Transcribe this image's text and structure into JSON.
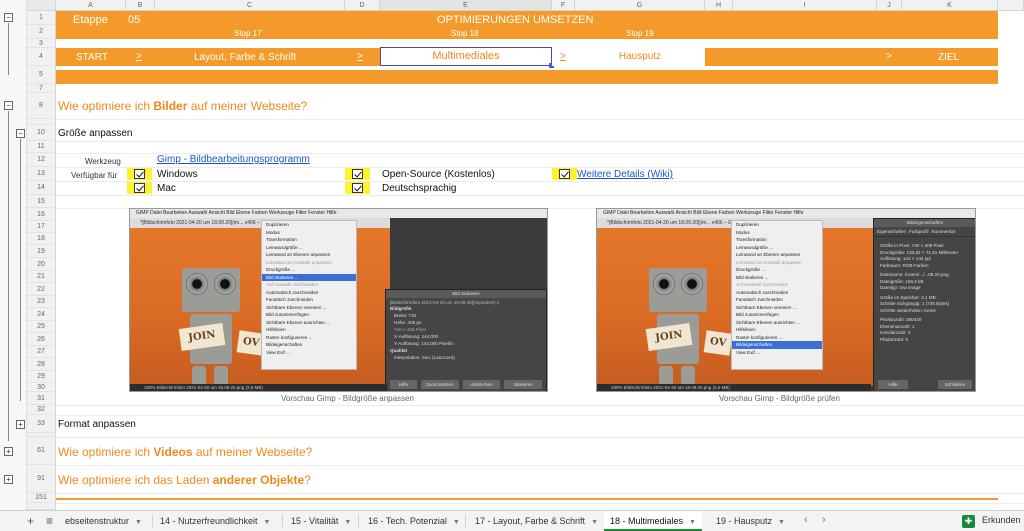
{
  "columns": [
    "A",
    "B",
    "C",
    "D",
    "E",
    "F",
    "G",
    "H",
    "I",
    "J",
    "K"
  ],
  "rows": [
    "1",
    "2",
    "3",
    "4",
    "5",
    "7",
    "8",
    "9",
    "10",
    "11",
    "12",
    "13",
    "14",
    "15",
    "16",
    "17",
    "18",
    "19",
    "20",
    "21",
    "22",
    "23",
    "24",
    "25",
    "26",
    "27",
    "28",
    "29",
    "30",
    "31",
    "32",
    "33",
    "61",
    "91",
    "151"
  ],
  "banner": {
    "etappe_label": "Etappe",
    "etappe_num": "05",
    "title": "OPTIMIERUNGEN UMSETZEN",
    "stops": [
      "Stop 17",
      "Stop 18",
      "Stop 19"
    ],
    "nav_start": "START",
    "nav_arrow": ">",
    "nav_items": [
      "Layout, Farbe & Schrift",
      "Multimediales",
      "Hausputz"
    ],
    "nav_end": "ZIEL"
  },
  "section_images": {
    "prefix": "Wie optimiere ich ",
    "bold": "Bilder",
    "suffix": " auf meiner Webseite?"
  },
  "subsection_resize": "Größe anpassen",
  "tool": {
    "label": "Werkzeug",
    "value": "Gimp - Bildbearbeitungsprogramm",
    "available_label": "Verfügbar für",
    "windows": "Windows",
    "mac": "Mac",
    "open_source": "Open-Source (Kostenlos)",
    "german": "Deutschsprachig",
    "details_link": "Weitere Details (Wiki)"
  },
  "screenshot_left": {
    "menubar": "  GIMP   Datei   Bearbeiten   Auswahl   Ansicht   Bild   Ebene   Farben   Werkzeuge   Filter   Fenster   Hilfe",
    "window_title": "*[Bildschirmfoto 2021-04-20 um 18.09.20](im...   x406 – GIMP",
    "menu_items": [
      "Duplizieren",
      "Modus",
      "Transformation",
      "Leinwandgröße ...",
      "Leinwand an Ebenen anpassen",
      "Leinwand an Auswahl anpassen",
      "Druckgröße ...",
      "Bild skalieren ...",
      "Auf Auswahl zuschneiden",
      "Automatisch zuschneiden",
      "Fanatisch zuschneiden",
      "Sichtbare Ebenen vereinen ...",
      "Bild zusammenfügen",
      "Sichtbare Ebenen ausrichten ...",
      "Hilfslinien",
      "Raster konfigurieren ...",
      "Bildeigenschaften",
      "View Exif ..."
    ],
    "dialog_title": "Bild skalieren",
    "dialog_sub": "[Bildschirmfoto 2021-04-20 um 18.09.20](importiert)-1",
    "dialog_lines": [
      "Bildgröße",
      "Breite:   740",
      "Höhe:     406    px",
      "740 × 406 Pixel",
      "X-Auflösung:  144,000",
      "Y-Auflösung:  144,000   Pixel/in",
      "Qualität",
      "Interpolation:  Sinc (Lanczos3)"
    ],
    "dialog_buttons": [
      "Hilfe",
      "Zurücksetzen",
      "Abbrechen",
      "Skalieren"
    ],
    "status": "100%    Bildschirmfoto 2021-04-20 um 18.09.20.png (2,6 MB)",
    "sign_text": "JOIN",
    "sign_text2": "OV"
  },
  "screenshot_right": {
    "menubar": "  GIMP   Datei   Bearbeiten   Auswahl   Ansicht   Bild   Ebene   Farben   Werkzeuge   Filter   Fenster   Hilfe",
    "window_title": "*[Bildschirmfoto 2021-04-20 um 18.09.20](im...   x406 – GIMP",
    "menu_items": [
      "Duplizieren",
      "Modus",
      "Transformation",
      "Leinwandgröße ...",
      "Leinwand an Ebenen anpassen",
      "Leinwand an Auswahl anpassen",
      "Druckgröße ...",
      "Bild skalieren ...",
      "Auf Auswahl zuschneiden",
      "Automatisch zuschneiden",
      "Fanatisch zuschneiden",
      "Sichtbare Ebenen vereinen ...",
      "Bild zusammenfügen",
      "Sichtbare Ebenen ausrichten ...",
      "Hilfslinien",
      "Raster konfigurieren ...",
      "Bildeigenschaften",
      "View Exif ..."
    ],
    "panel_title": "Bildeigenschaften",
    "panel_tabs": [
      "Eigenschaften",
      "Farbprofil",
      "Kommentar"
    ],
    "panel_lines": [
      "Größe in Pixel:  740 × 406 Pixel",
      "Druckgröße:  130,52 × 71,61 Millimeter",
      "Auflösung:  144 × 144 ppi",
      "Farbraum:  RGB-Farben",
      "Dateiname:  /Users/.../...09.20.png",
      "Dateigröße:  169,2 kB",
      "Dateityp:  raw image",
      "Größe im Speicher:  3,1 MB",
      "Schritte rückgängig:  1 (735 Bytes)",
      "Schritte wiederholen:  Keine",
      "Pixelanzahl:  300440",
      "Ebenenanzahl:  1",
      "Kanalanzahl:  0",
      "Pfadanzahl:  0"
    ],
    "panel_buttons": [
      "Hilfe",
      "Schließen"
    ],
    "status": "100%    Bildschirmfoto 2021-04-20 um 18.09.20.png (2,6 MB)",
    "sign_text": "JOIN",
    "sign_text2": "OV"
  },
  "caption_left": "Vorschau Gimp - Bildgröße anpassen",
  "caption_right": "Vorschau Gimp - Bildgröße prüfen",
  "subsection_format": "Format anpassen",
  "section_videos": {
    "prefix": "Wie optimiere ich ",
    "bold": "Videos",
    "suffix": " auf meiner Webseite?"
  },
  "section_objects": {
    "prefix": "Wie optimiere ich das Laden ",
    "bold": "anderer Objekte",
    "suffix": "?"
  },
  "tabs": [
    "ebseitenstruktur",
    "14 - Nutzerfreundlichkeit",
    "15 - Vitalität",
    "16 - Tech. Potenzial",
    "17 - Layout, Farbe & Schrift",
    "18 - Multimediales",
    "19 - Hausputz"
  ],
  "active_tab": "18 - Multimediales",
  "add_sheet": "+",
  "all_sheets": "≡",
  "scroll_left": "‹",
  "scroll_right": "›",
  "explore_label": "Erkunden",
  "outline_minus": "−",
  "outline_plus": "+",
  "colors": {
    "accent": "#F39A2B",
    "checkbox": "#FFF330",
    "link": "#1A56C8",
    "active_tab": "#1A8A3A"
  }
}
